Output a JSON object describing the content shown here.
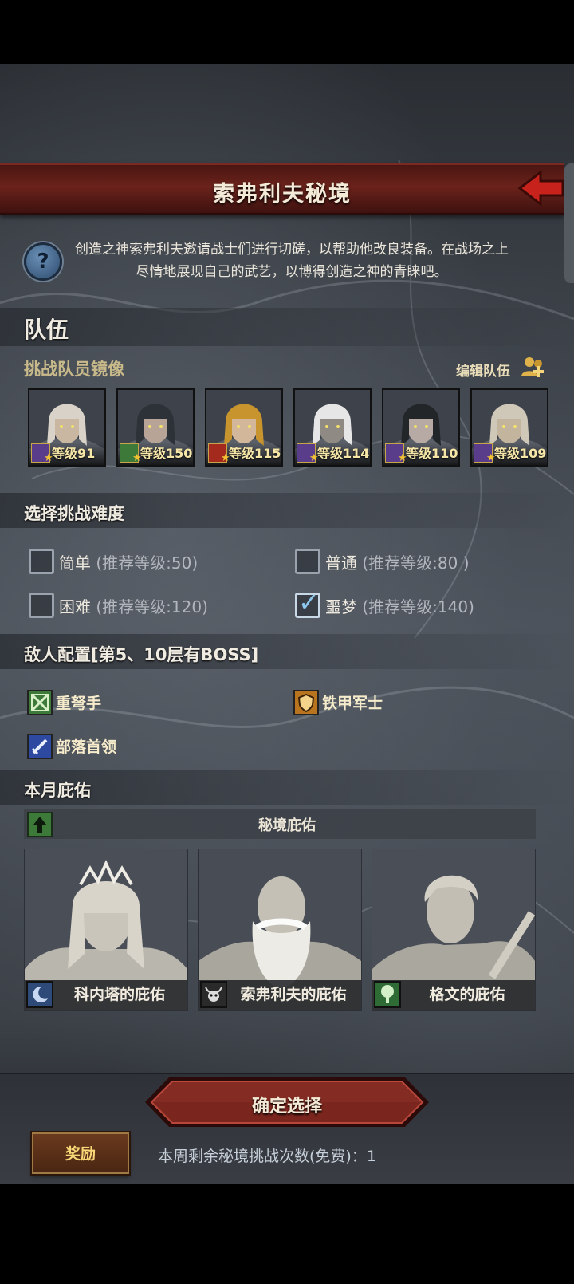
{
  "header": {
    "title": "索弗利夫秘境",
    "back_icon": "back-arrow-icon"
  },
  "intro": {
    "text": "创造之神索弗利夫邀请战士们进行切磋，以帮助他改良装备。在战场之上尽情地展现自己的武艺，以博得创造之神的青睐吧。"
  },
  "team": {
    "heading": "队伍",
    "subheading": "挑战队员镜像",
    "edit_label": "编辑队伍",
    "members": [
      {
        "level": "等级91",
        "class_color": "#5a3d8a"
      },
      {
        "level": "等级150",
        "class_color": "#3d7a3a"
      },
      {
        "level": "等级115",
        "class_color": "#a52a1e"
      },
      {
        "level": "等级114",
        "class_color": "#5a3d8a"
      },
      {
        "level": "等级110",
        "class_color": "#5a3d8a"
      },
      {
        "level": "等级109",
        "class_color": "#5a3d8a"
      }
    ]
  },
  "difficulty": {
    "heading": "选择挑战难度",
    "options": [
      {
        "name": "简单",
        "rec": "(推荐等级:50)",
        "checked": false
      },
      {
        "name": "普通",
        "rec": "(推荐等级:80 )",
        "checked": false
      },
      {
        "name": "困难",
        "rec": "(推荐等级:120)",
        "checked": false
      },
      {
        "name": "噩梦",
        "rec": "(推荐等级:140)",
        "checked": true
      }
    ]
  },
  "enemies": {
    "heading": "敌人配置[第5、10层有BOSS]",
    "list": [
      {
        "name": "重弩手",
        "icon": "crossbow-class-icon",
        "color": "#3d7a3a"
      },
      {
        "name": "铁甲军士",
        "icon": "shield-class-icon",
        "color": "#b8741e"
      },
      {
        "name": "部落首领",
        "icon": "sword-class-icon",
        "color": "#2d4aa0"
      }
    ]
  },
  "blessing": {
    "heading": "本月庇佑",
    "bar_title": "秘境庇佑",
    "cards": [
      {
        "label": "科内塔的庇佑",
        "icon_color": "#2e4a78"
      },
      {
        "label": "索弗利夫的庇佑",
        "icon_color": "#2a2a2a"
      },
      {
        "label": "格文的庇佑",
        "icon_color": "#2f6b35"
      }
    ]
  },
  "footer": {
    "confirm_label": "确定选择",
    "reward_label": "奖励",
    "remaining_text": "本周剩余秘境挑战次数(免费)：1"
  }
}
